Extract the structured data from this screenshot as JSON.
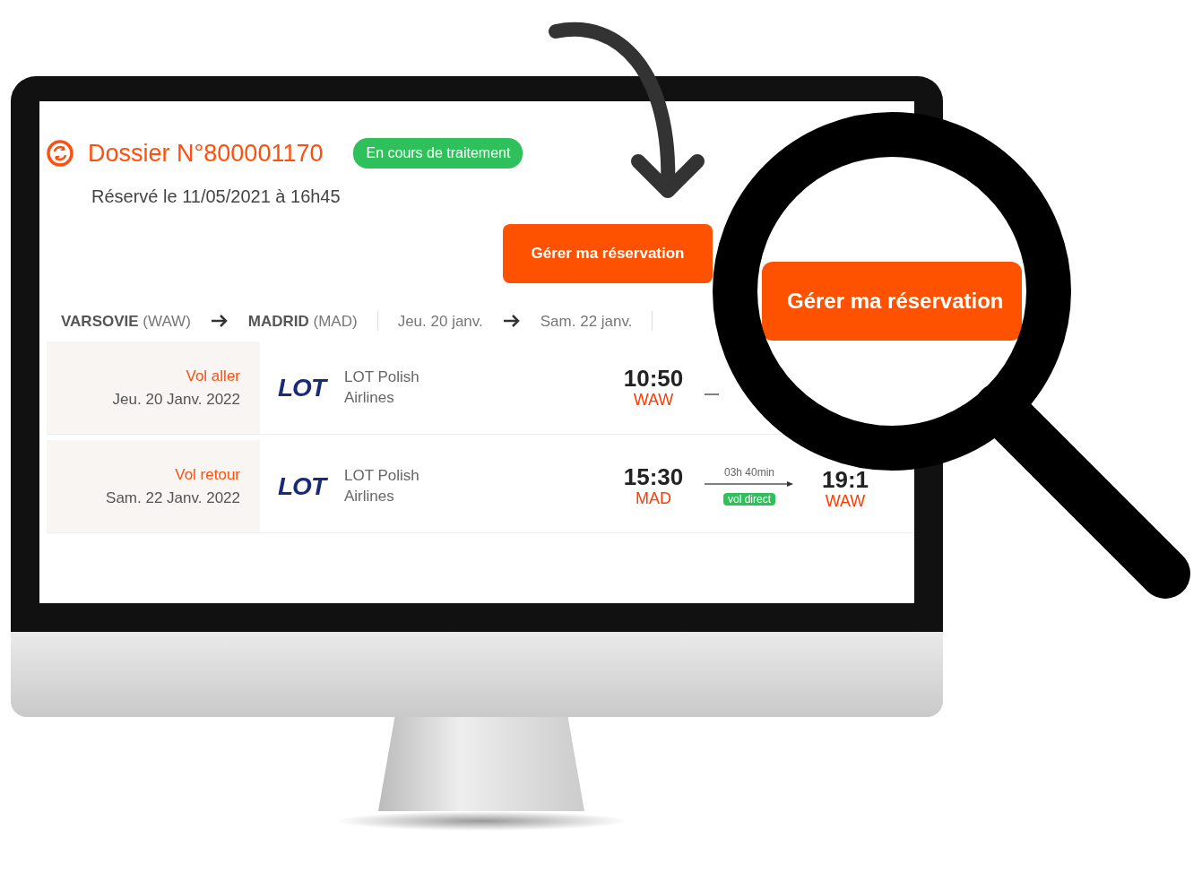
{
  "dossier": {
    "title": "Dossier N°800001170",
    "status": "En cours de traitement",
    "booked": "Réservé le 11/05/2021 à 16h45"
  },
  "manage_button": "Gérer ma réservation",
  "route": [
    {
      "kind": "city",
      "text": "**VARSOVIE** (WAW)"
    },
    {
      "kind": "arrow"
    },
    {
      "kind": "city",
      "text": "**MADRID** (MAD)"
    },
    {
      "kind": "divider"
    },
    {
      "kind": "date",
      "text": "Jeu. 20 janv."
    },
    {
      "kind": "arrow"
    },
    {
      "kind": "date",
      "text": "Sam. 22 janv."
    },
    {
      "kind": "divider"
    }
  ],
  "flights": [
    {
      "label": "Vol aller",
      "date": "Jeu. 20 Janv. 2022",
      "logo": "LOT",
      "airline": "LOT Polish Airlines",
      "departure_time": "10:50",
      "departure_airport": "WAW"
    },
    {
      "label": "Vol retour",
      "date": "Sam. 22 Janv. 2022",
      "logo": "LOT",
      "airline": "LOT Polish Airlines",
      "departure_time": "15:30",
      "departure_airport": "MAD",
      "duration": "03h 40min",
      "badge": "vol direct",
      "arrival_time": "19:1",
      "arrival_airport": "WAW"
    }
  ],
  "magnified_button": "Gérer ma réservation"
}
